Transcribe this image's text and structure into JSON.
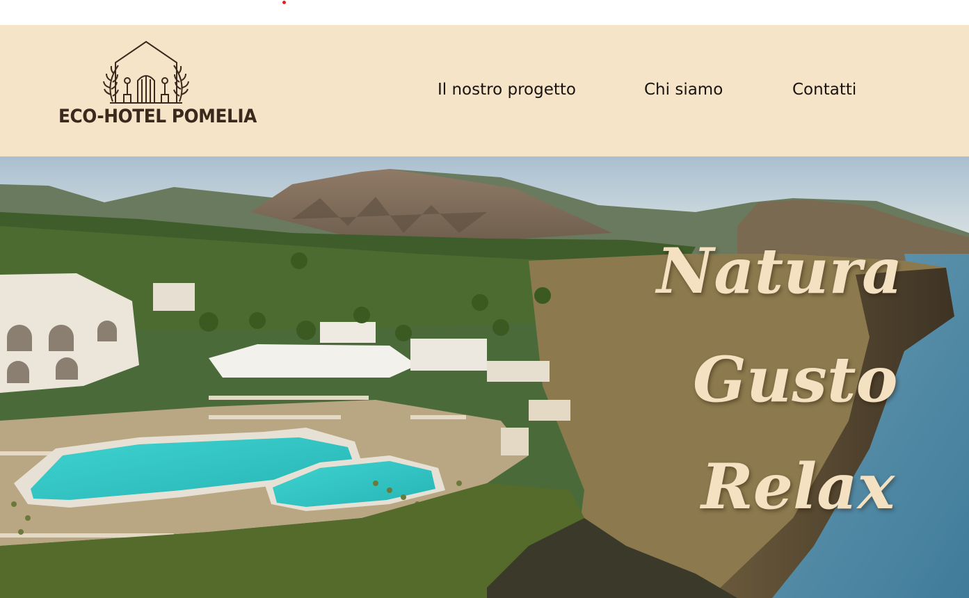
{
  "header": {
    "brand_name": "ECO-HOTEL POMELIA",
    "logo_icon": "house-with-olive-branches-icon",
    "background_color": "#f6e4c8",
    "nav": [
      {
        "label": "Il nostro progetto"
      },
      {
        "label": "Chi siamo"
      },
      {
        "label": "Contatti"
      }
    ]
  },
  "hero": {
    "image": "aerial-view-of-cliffside-hotel-with-pools-and-volcano",
    "taglines": [
      "Natura",
      "Gusto",
      "Relax"
    ],
    "tagline_color": "#f4e1c2"
  },
  "colors": {
    "accent_red": "#e02020",
    "text_dark": "#1a1410",
    "logo_brown": "#3a2a1e"
  }
}
